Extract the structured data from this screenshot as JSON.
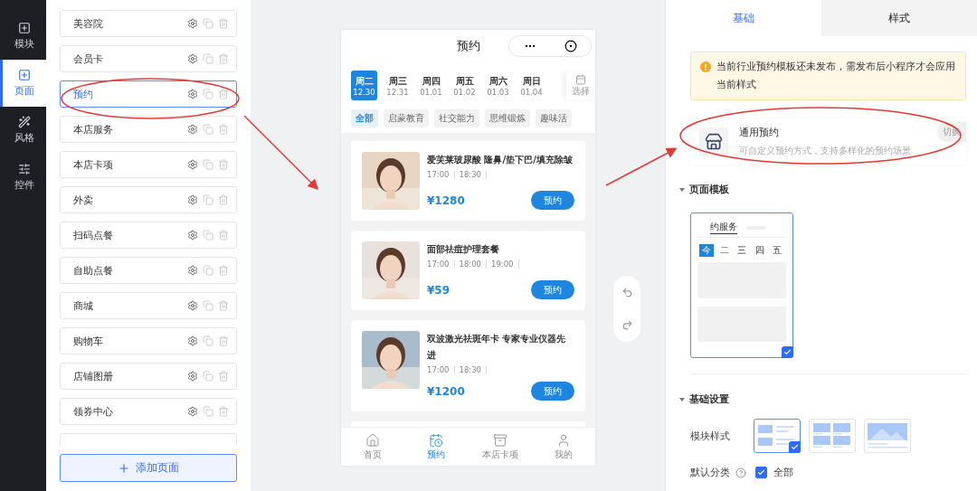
{
  "sidebar": {
    "items": [
      {
        "label": "模块",
        "selected": false
      },
      {
        "label": "页面",
        "selected": true
      },
      {
        "label": "风格",
        "selected": false
      },
      {
        "label": "控件",
        "selected": false
      }
    ]
  },
  "pages": {
    "items": [
      {
        "label": "美容院",
        "selected": false
      },
      {
        "label": "会员卡",
        "selected": false
      },
      {
        "label": "预约",
        "selected": true
      },
      {
        "label": "本店服务",
        "selected": false
      },
      {
        "label": "本店卡项",
        "selected": false
      },
      {
        "label": "外卖",
        "selected": false
      },
      {
        "label": "扫码点餐",
        "selected": false
      },
      {
        "label": "自助点餐",
        "selected": false
      },
      {
        "label": "商城",
        "selected": false
      },
      {
        "label": "购物车",
        "selected": false
      },
      {
        "label": "店铺图册",
        "selected": false
      },
      {
        "label": "领券中心",
        "selected": false
      }
    ],
    "add_button": "添加页面"
  },
  "phone": {
    "title": "预约",
    "dates": [
      {
        "day": "周二",
        "date": "12.30",
        "selected": true
      },
      {
        "day": "周三",
        "date": "12.31",
        "selected": false
      },
      {
        "day": "周四",
        "date": "01.01",
        "selected": false
      },
      {
        "day": "周五",
        "date": "01.02",
        "selected": false
      },
      {
        "day": "周六",
        "date": "01.03",
        "selected": false
      },
      {
        "day": "周日",
        "date": "01.04",
        "selected": false
      }
    ],
    "choose": "选择",
    "categories": [
      {
        "label": "全部",
        "selected": true
      },
      {
        "label": "启蒙教育",
        "selected": false
      },
      {
        "label": "社交能力",
        "selected": false
      },
      {
        "label": "思维锻炼",
        "selected": false
      },
      {
        "label": "趣味活",
        "selected": false
      }
    ],
    "services": [
      {
        "title": "爱芙莱玻尿酸 隆鼻/垫下巴/填充除皱",
        "times": [
          "17:00",
          "18:30"
        ],
        "price": "¥1280",
        "button": "预约"
      },
      {
        "title": "面部祛痘护理套餐",
        "times": [
          "17:00",
          "18:00",
          "19:00"
        ],
        "price": "¥59",
        "button": "预约"
      },
      {
        "title": "双波激光祛斑年卡 专家专业仪器先进",
        "times": [
          "17:00",
          "18:30"
        ],
        "price": "¥1200",
        "button": "预约"
      }
    ],
    "tabbar": [
      {
        "label": "首页",
        "selected": false
      },
      {
        "label": "预约",
        "selected": true
      },
      {
        "label": "本店卡项",
        "selected": false
      },
      {
        "label": "我的",
        "selected": false
      }
    ]
  },
  "settings": {
    "tabs": [
      {
        "label": "基础",
        "selected": true
      },
      {
        "label": "样式",
        "selected": false
      }
    ],
    "notice": "当前行业预约模板还未发布，需发布后小程序才会应用当前样式",
    "template": {
      "name": "通用预约",
      "description": "可自定义预约方式，支持多样化的预约场景",
      "switch": "切换"
    },
    "page_template": {
      "heading": "页面模板",
      "preview_tab": "约服务",
      "days": [
        {
          "label": "今",
          "selected": true
        },
        {
          "label": "二",
          "selected": false
        },
        {
          "label": "三",
          "selected": false
        },
        {
          "label": "四",
          "selected": false
        },
        {
          "label": "五",
          "selected": false
        }
      ],
      "checked": true
    },
    "basic": {
      "heading": "基础设置",
      "module_style_label": "模块样式",
      "module_styles": [
        {
          "kind": "list",
          "selected": true
        },
        {
          "kind": "grid",
          "selected": false
        },
        {
          "kind": "banner",
          "selected": false
        }
      ],
      "category_label": "默认分类",
      "category": {
        "label": "全部",
        "checked": true
      }
    }
  }
}
